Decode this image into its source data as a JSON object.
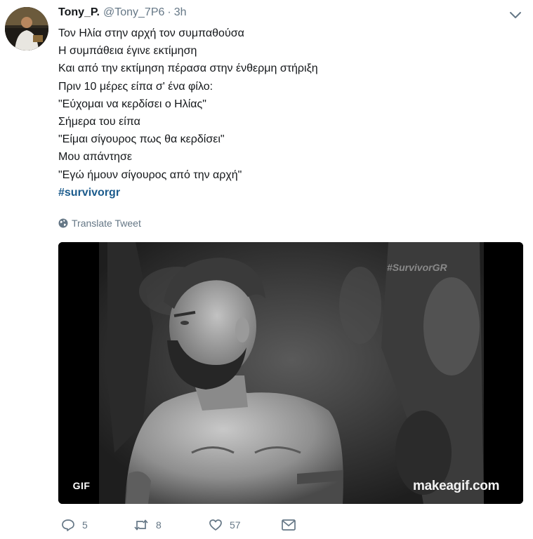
{
  "tweet": {
    "display_name": "Tony_P.",
    "handle": "@Tony_7P6",
    "separator": "·",
    "time": "3h",
    "lines": [
      "Τον Ηλία στην αρχή τον συμπαθούσα",
      "Η συμπάθεια έγινε εκτίμηση",
      "Και από την εκτίμηση πέρασα στην ένθερμη στήριξη",
      "Πριν 10 μέρες είπα σ' ένα φίλο:",
      "\"Εύχομαι να κερδίσει ο Ηλίας\"",
      "Σήμερα του είπα",
      "\"Είμαι σίγουρος πως θα κερδίσει\"",
      "Μου απάντησε",
      "\"Εγώ ήμουν σίγουρος από την αρχή\""
    ],
    "hashtag": "#survivorgr",
    "translate_label": "Translate Tweet"
  },
  "media": {
    "badge": "GIF",
    "watermark_top": "#SurvivorGR",
    "watermark_bottom": "makeagif.com"
  },
  "actions": {
    "replies": "5",
    "retweets": "8",
    "likes": "57"
  },
  "icons": {
    "caret": "chevron-down-icon",
    "translate": "globe-icon",
    "reply": "reply-icon",
    "retweet": "retweet-icon",
    "like": "heart-icon",
    "message": "envelope-icon"
  },
  "colors": {
    "hashtag": "#1b5b8c",
    "muted": "#657786",
    "text": "#14171a"
  }
}
